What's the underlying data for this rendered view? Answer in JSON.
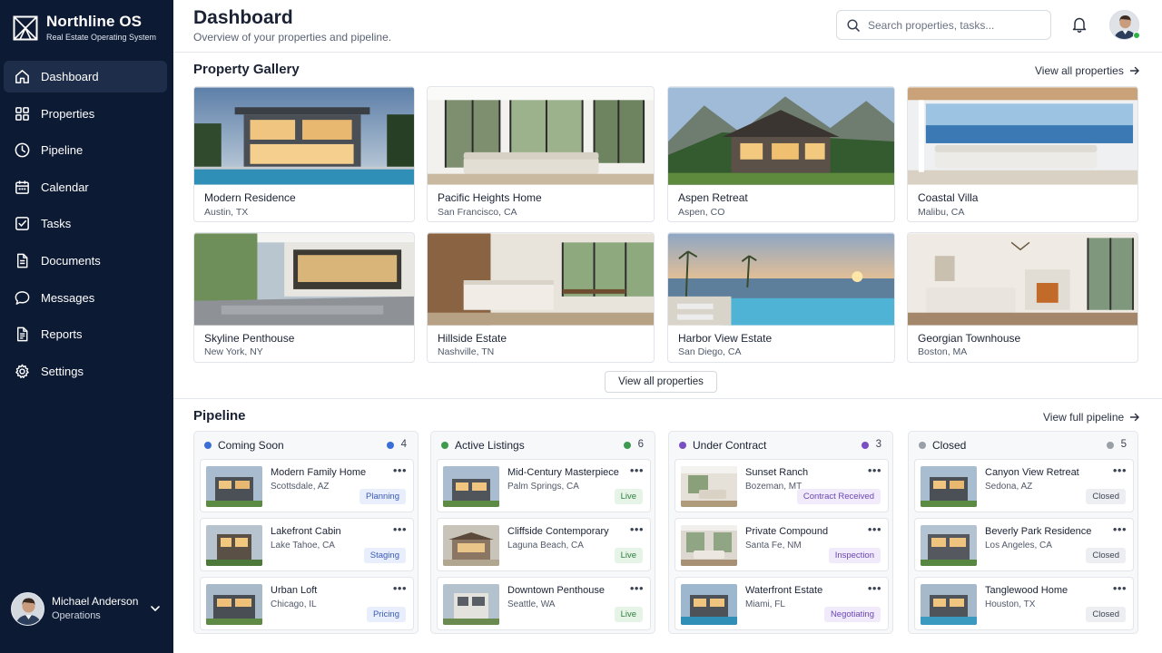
{
  "brand": {
    "name": "Northline OS",
    "tagline": "Real Estate Operating System"
  },
  "nav": [
    {
      "label": "Dashboard",
      "icon": "home-icon",
      "active": true
    },
    {
      "label": "Properties",
      "icon": "grid-icon"
    },
    {
      "label": "Pipeline",
      "icon": "clock-icon"
    },
    {
      "label": "Calendar",
      "icon": "calendar-icon"
    },
    {
      "label": "Tasks",
      "icon": "checkbox-icon"
    },
    {
      "label": "Documents",
      "icon": "document-icon"
    },
    {
      "label": "Messages",
      "icon": "chat-icon"
    },
    {
      "label": "Reports",
      "icon": "report-icon"
    },
    {
      "label": "Settings",
      "icon": "gear-icon"
    }
  ],
  "user": {
    "name": "Michael Anderson",
    "role": "Operations"
  },
  "header": {
    "title": "Dashboard",
    "subtitle": "Overview of your properties and pipeline.",
    "search_placeholder": "Search properties, tasks..."
  },
  "gallery": {
    "title": "Property Gallery",
    "view_all_link": "View all properties",
    "view_all_button": "View all properties",
    "properties": [
      {
        "name": "Modern Residence",
        "location": "Austin, TX"
      },
      {
        "name": "Pacific Heights Home",
        "location": "San Francisco, CA"
      },
      {
        "name": "Aspen Retreat",
        "location": "Aspen, CO"
      },
      {
        "name": "Coastal Villa",
        "location": "Malibu, CA"
      },
      {
        "name": "Skyline Penthouse",
        "location": "New York, NY"
      },
      {
        "name": "Hillside Estate",
        "location": "Nashville, TN"
      },
      {
        "name": "Harbor View Estate",
        "location": "San Diego, CA"
      },
      {
        "name": "Georgian Townhouse",
        "location": "Boston, MA"
      }
    ]
  },
  "pipeline": {
    "title": "Pipeline",
    "view_link": "View full pipeline",
    "columns": [
      {
        "title": "Coming Soon",
        "count": "4",
        "color": "#3b6fd8",
        "deals": [
          {
            "name": "Modern Family Home",
            "location": "Scottsdale, AZ",
            "status": "Planning"
          },
          {
            "name": "Lakefront Cabin",
            "location": "Lake Tahoe, CA",
            "status": "Staging"
          },
          {
            "name": "Urban Loft",
            "location": "Chicago, IL",
            "status": "Pricing"
          }
        ]
      },
      {
        "title": "Active Listings",
        "count": "6",
        "color": "#3e9a4e",
        "deals": [
          {
            "name": "Mid-Century Masterpiece",
            "location": "Palm Springs, CA",
            "status": "Live"
          },
          {
            "name": "Cliffside Contemporary",
            "location": "Laguna Beach, CA",
            "status": "Live"
          },
          {
            "name": "Downtown Penthouse",
            "location": "Seattle, WA",
            "status": "Live"
          }
        ]
      },
      {
        "title": "Under Contract",
        "count": "3",
        "color": "#7a4fc4",
        "deals": [
          {
            "name": "Sunset Ranch",
            "location": "Bozeman, MT",
            "status": "Contract Received"
          },
          {
            "name": "Private Compound",
            "location": "Santa Fe, NM",
            "status": "Inspection"
          },
          {
            "name": "Waterfront Estate",
            "location": "Miami, FL",
            "status": "Negotiating"
          }
        ]
      },
      {
        "title": "Closed",
        "count": "5",
        "color": "#9aa0a8",
        "deals": [
          {
            "name": "Canyon View Retreat",
            "location": "Sedona, AZ",
            "status": "Closed"
          },
          {
            "name": "Beverly Park Residence",
            "location": "Los Angeles, CA",
            "status": "Closed"
          },
          {
            "name": "Tanglewood Home",
            "location": "Houston, TX",
            "status": "Closed"
          }
        ]
      }
    ]
  }
}
